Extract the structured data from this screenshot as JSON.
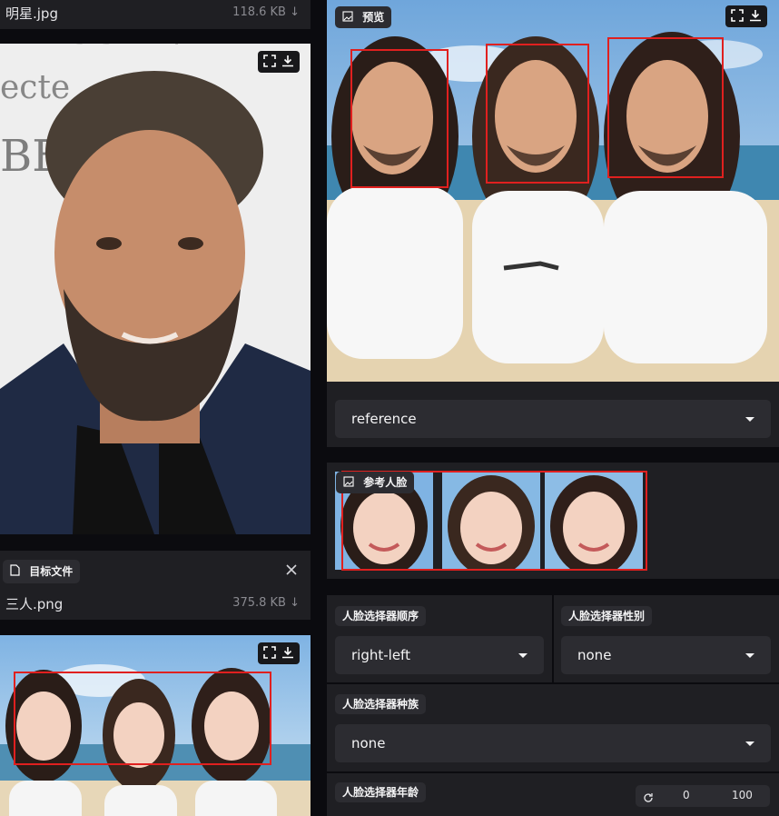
{
  "left": {
    "top_file": {
      "name": "明星.jpg",
      "size": "118.6 KB ↓"
    },
    "target": {
      "chip_label": "目标文件",
      "file_name": "三人.png",
      "file_size": "375.8 KB ↓"
    }
  },
  "right": {
    "preview_label": "预览",
    "face_selector_mode_value": "reference",
    "reference_faces_label": "参考人脸",
    "order": {
      "label": "人脸选择器顺序",
      "value": "right-left"
    },
    "gender": {
      "label": "人脸选择器性别",
      "value": "none"
    },
    "race": {
      "label": "人脸选择器种族",
      "value": "none"
    },
    "age": {
      "label": "人脸选择器年龄",
      "min": "0",
      "max": "100"
    }
  },
  "icons": [
    "fullscreen-icon",
    "download-icon",
    "image-icon",
    "file-icon",
    "close-icon",
    "reset-icon",
    "chevron-down-icon"
  ]
}
